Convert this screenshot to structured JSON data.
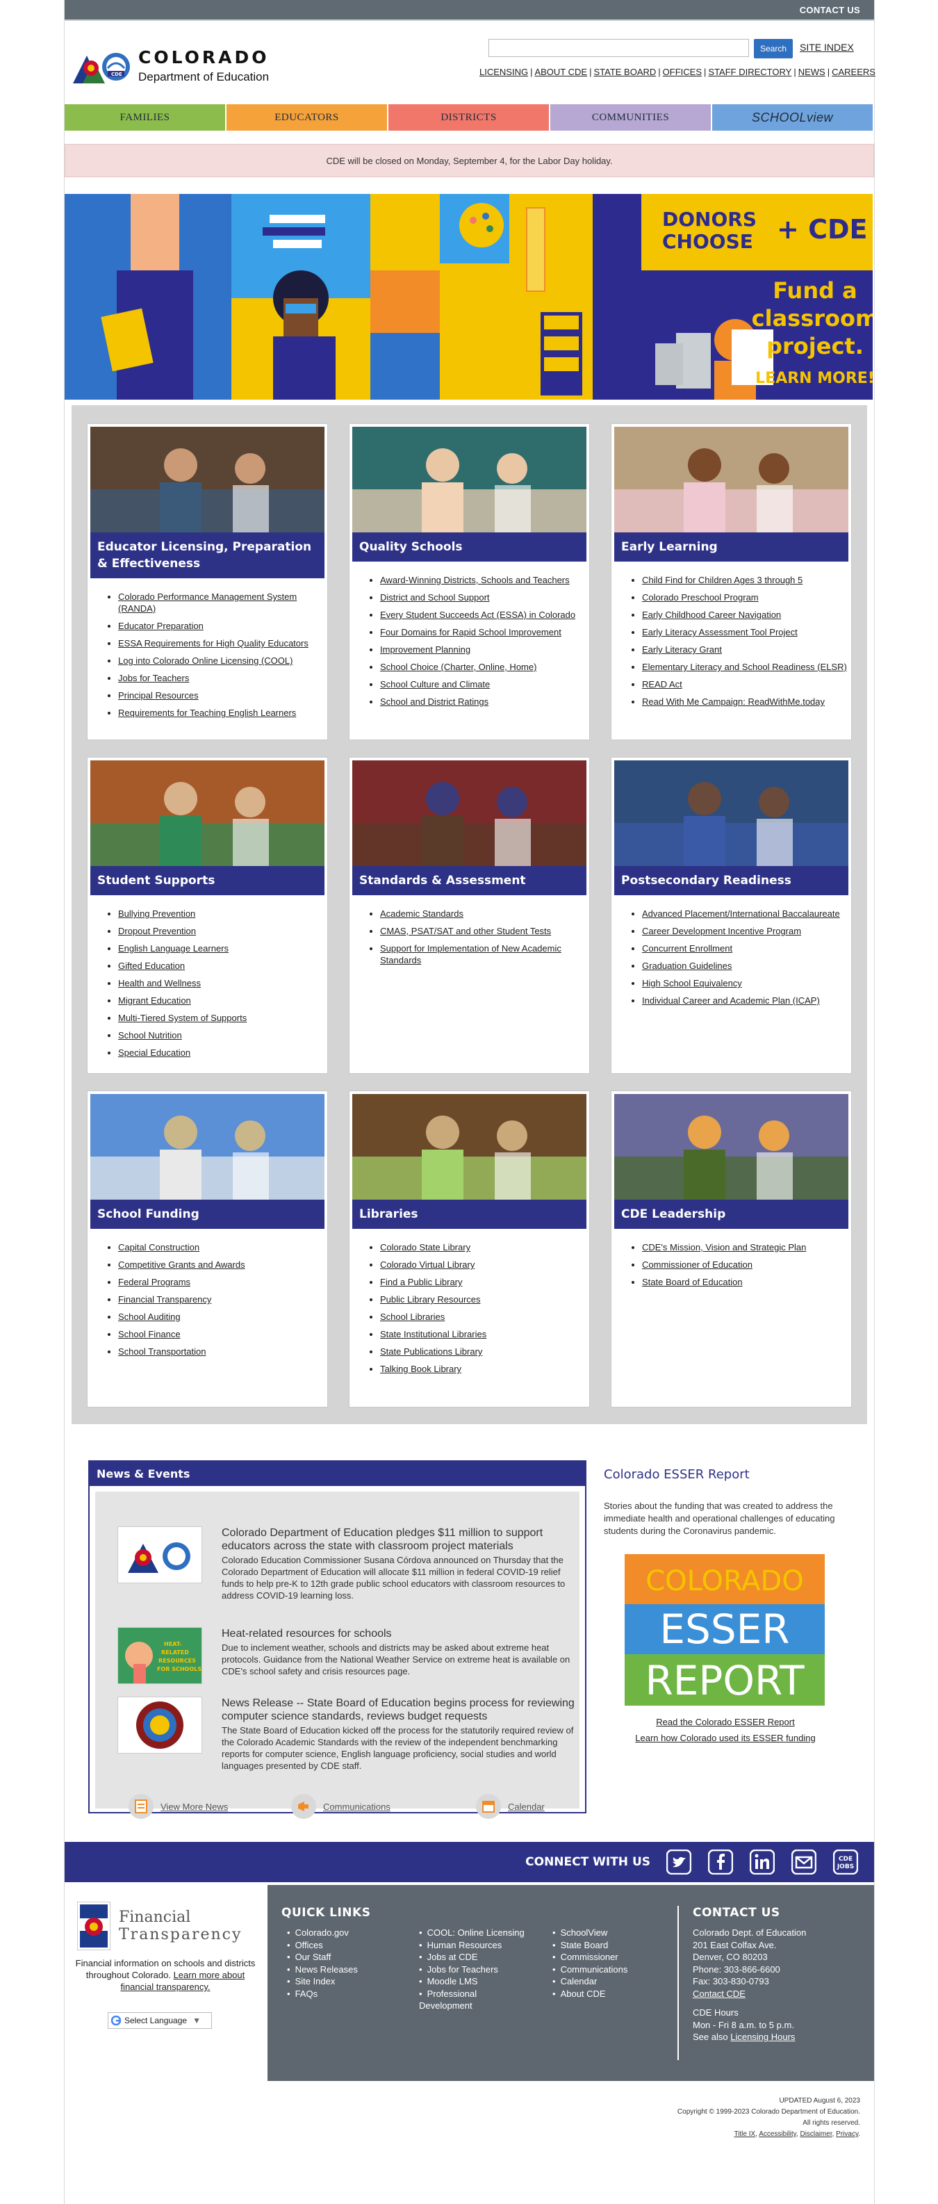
{
  "topbar": {
    "contact": "CONTACT US"
  },
  "header": {
    "org_name": "COLORADO",
    "org_dept": "Department of Education",
    "search_placeholder": "",
    "search_button": "Search",
    "site_index": "SITE INDEX",
    "util_links": [
      "LICENSING",
      "ABOUT CDE",
      "STATE BOARD",
      "OFFICES",
      "STAFF DIRECTORY",
      "NEWS",
      "CAREERS"
    ]
  },
  "nav": {
    "families": "FAMILIES",
    "educators": "EDUCATORS",
    "districts": "DISTRICTS",
    "communities": "COMMUNITIES",
    "schoolview": "SCHOOLview"
  },
  "alert": "CDE will be closed on Monday, September 4, for the Labor Day holiday.",
  "banner": {
    "donors": "DONORS",
    "choose": "CHOOSE",
    "plus_cde": "+ CDE",
    "headline": [
      "Fund a",
      "classroom",
      "project."
    ],
    "cta": "LEARN MORE!"
  },
  "cards": [
    {
      "title": "Educator Licensing, Preparation & Effectiveness",
      "items": [
        "Colorado Performance Management System (RANDA)",
        "Educator Preparation",
        "ESSA Requirements for High Quality Educators",
        "Log into Colorado Online Licensing (COOL)",
        "Jobs for Teachers",
        "Principal Resources",
        "Requirements for Teaching English Learners"
      ]
    },
    {
      "title": "Quality Schools",
      "items": [
        "Award-Winning Districts, Schools and Teachers",
        "District and School Support",
        "Every Student Succeeds Act (ESSA) in Colorado",
        "Four Domains for Rapid School Improvement",
        "Improvement Planning",
        "School Choice (Charter, Online, Home)",
        "School Culture and Climate",
        "School and District Ratings"
      ]
    },
    {
      "title": "Early Learning",
      "items": [
        "Child Find for Children Ages 3 through 5",
        "Colorado Preschool Program",
        "Early Childhood Career Navigation",
        "Early Literacy Assessment Tool Project",
        "Early Literacy Grant",
        "Elementary Literacy and School Readiness (ELSR)",
        "READ Act",
        "Read With Me Campaign: ReadWithMe.today"
      ]
    },
    {
      "title": "Student Supports",
      "items": [
        "Bullying Prevention",
        "Dropout Prevention",
        "English Language Learners",
        "Gifted Education",
        "Health and Wellness",
        "Migrant Education",
        "Multi-Tiered System of Supports",
        "School Nutrition",
        "Special Education"
      ]
    },
    {
      "title": "Standards & Assessment",
      "items": [
        "Academic Standards",
        "CMAS, PSAT/SAT and other Student Tests",
        "Support for Implementation of New Academic Standards"
      ]
    },
    {
      "title": "Postsecondary Readiness",
      "items": [
        "Advanced Placement/International Baccalaureate",
        "Career Development Incentive Program",
        "Concurrent Enrollment",
        "Graduation Guidelines",
        "High School Equivalency",
        "Individual Career and Academic Plan (ICAP)"
      ]
    },
    {
      "title": "School Funding",
      "items": [
        "Capital Construction",
        "Competitive Grants and Awards",
        "Federal Programs",
        "Financial Transparency",
        "School Auditing",
        "School Finance",
        "School Transportation"
      ]
    },
    {
      "title": "Libraries",
      "items": [
        "Colorado State Library",
        "Colorado Virtual Library",
        "Find a Public Library",
        "Public Library Resources",
        "School Libraries",
        "State Institutional Libraries",
        "State Publications Library",
        "Talking Book Library"
      ]
    },
    {
      "title": "CDE Leadership",
      "items": [
        "CDE's Mission, Vision and Strategic Plan",
        "Commissioner of Education",
        "State Board of Education"
      ]
    }
  ],
  "news": {
    "heading": "News & Events",
    "items": [
      {
        "title": "Colorado Department of Education pledges $11 million to support educators across the state with classroom project materials",
        "desc": "Colorado Education Commissioner Susana Córdova announced on Thursday that the Colorado Department of Education will allocate $11 million in federal COVID-19 relief funds to help pre-K to 12th grade public school educators with classroom resources to address COVID-19 learning loss."
      },
      {
        "title": "Heat-related resources for schools",
        "desc": "Due to inclement weather, schools and districts may be asked about extreme heat protocols. Guidance from the National Weather Service on extreme heat is available on CDE's school safety and crisis resources page.",
        "thumb_text": "HEAT-RELATED RESOURCES FOR SCHOOLS"
      },
      {
        "title": "News Release -- State Board of Education begins process for reviewing computer science standards, reviews budget requests",
        "desc": "The State Board of Education kicked off the process for the statutorily required review of the Colorado Academic Standards with the review of the independent benchmarking reports for computer science, English language proficiency, social studies and world languages presented by CDE staff."
      }
    ],
    "links": [
      "View More News",
      "Communications",
      "Calendar"
    ]
  },
  "esser": {
    "title": "Colorado ESSER Report",
    "desc": "Stories about the funding that was created to address the immediate health and operational challenges of educating students during the Coronavirus pandemic.",
    "img_words": [
      "COLORADO",
      "ESSER",
      "REPORT"
    ],
    "link1": "Read the Colorado ESSER Report",
    "link2": "Learn how Colorado used its ESSER funding"
  },
  "connect": {
    "label": "CONNECT WITH US",
    "cde_jobs": [
      "CDE",
      "JOBS"
    ]
  },
  "footer": {
    "ft_title1": "Financial",
    "ft_title2": "Transparency",
    "ft_text": "Financial information on schools and districts throughout Colorado.",
    "ft_link": "Learn more about financial transparency.",
    "translate": "Select Language",
    "quick_links_heading": "QUICK LINKS",
    "col1": [
      "Colorado.gov",
      "Offices",
      "Our Staff",
      "News Releases",
      "Site Index",
      "FAQs"
    ],
    "col2": [
      "COOL: Online Licensing",
      "Human Resources",
      "Jobs at CDE",
      "Jobs for Teachers",
      "Moodle LMS",
      "Professional Development"
    ],
    "col3": [
      "SchoolView",
      "State Board",
      "Commissioner",
      "Communications",
      "Calendar",
      "About CDE"
    ],
    "contact_heading": "CONTACT US",
    "contact_lines": [
      "Colorado Dept. of Education",
      "201 East Colfax Ave.",
      "Denver, CO 80203",
      "Phone: 303-866-6600",
      "Fax: 303-830-0793"
    ],
    "contact_link": "Contact CDE",
    "hours_heading": "CDE Hours",
    "hours": "Mon - Fri 8 a.m. to 5 p.m.",
    "see_also": "See also",
    "licensing_hours": "Licensing Hours"
  },
  "copyright": {
    "updated": "UPDATED August 6, 2023",
    "line": "Copyright © 1999-2023 Colorado Department of Education.",
    "rights": "All rights reserved.",
    "links": [
      "Title IX",
      "Accessibility",
      "Disclaimer",
      "Privacy"
    ]
  }
}
